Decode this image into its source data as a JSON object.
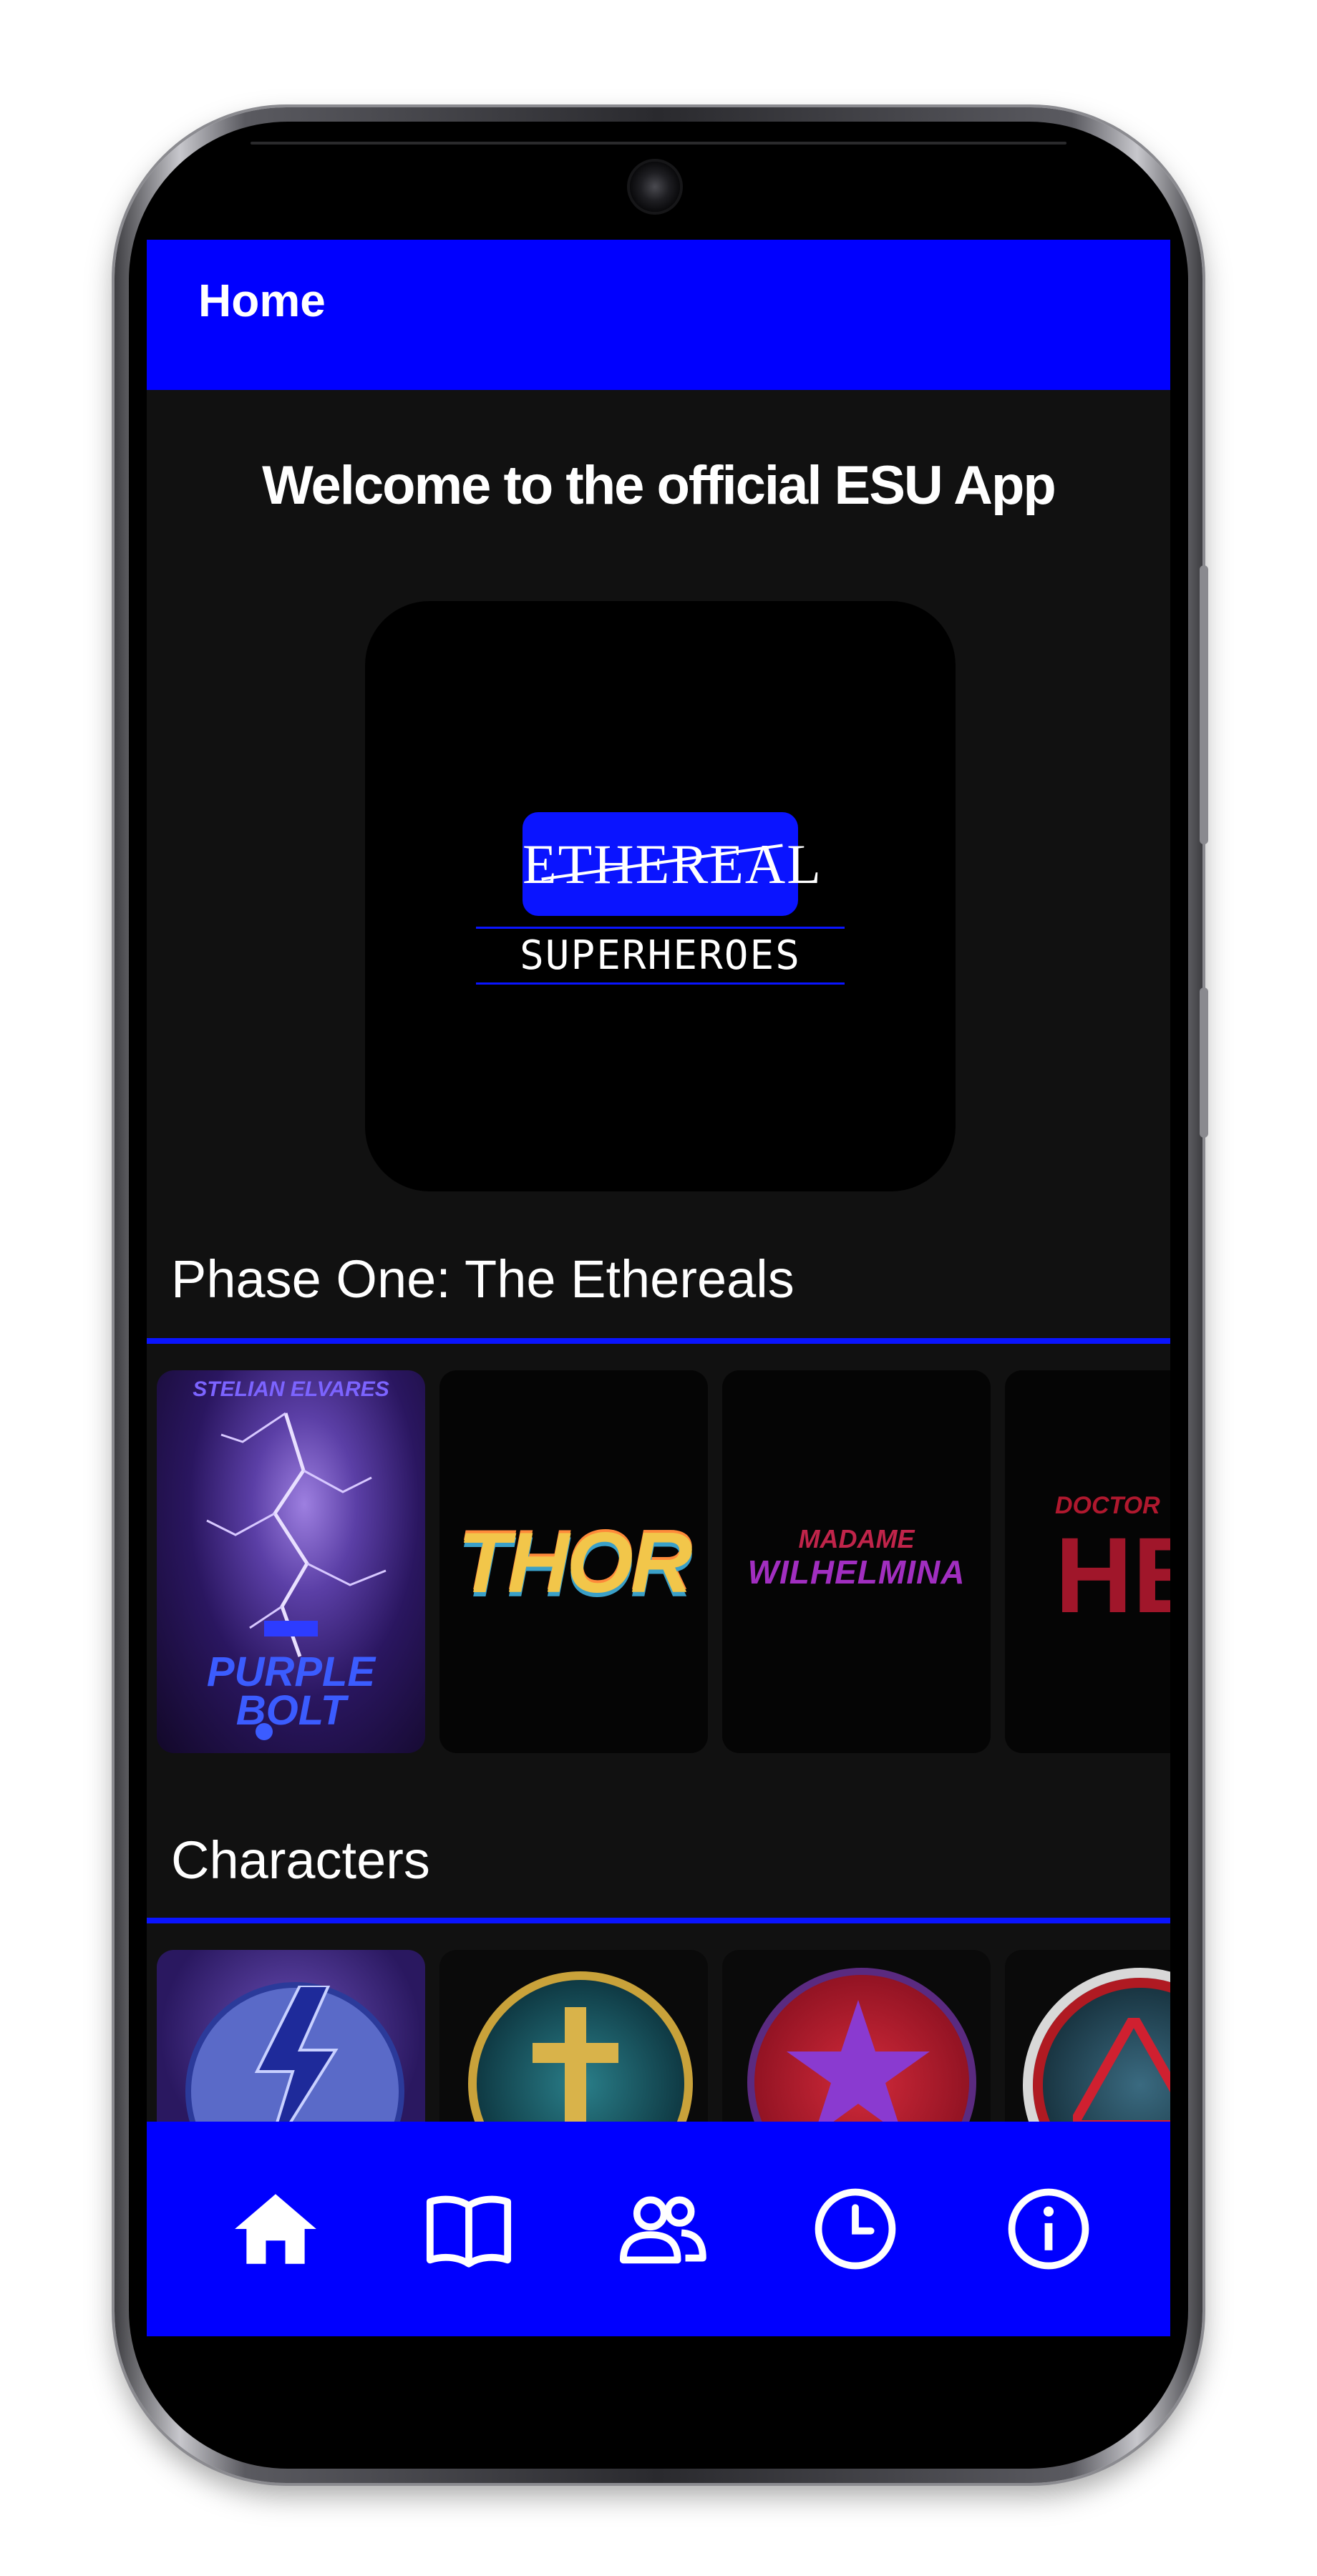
{
  "app_bar": {
    "title": "Home"
  },
  "welcome": {
    "text": "Welcome to the official ESU App"
  },
  "logo": {
    "line1": "ETHEREAL",
    "line2": "SUPERHEROES"
  },
  "phase_one": {
    "title": "Phase One: The Ethereals",
    "items": [
      {
        "top_text": "STELIAN ELVARES",
        "title": "PURPLE BOLT"
      },
      {
        "title": "THOR"
      },
      {
        "line1": "MADAME",
        "line2": "WILHELMINA"
      },
      {
        "line1": "DOCTOR",
        "line2": "HEX"
      }
    ]
  },
  "characters": {
    "title": "Characters",
    "items": [
      {
        "emblem": "lightning-bolt-emblem"
      },
      {
        "emblem": "gold-hammer-emblem"
      },
      {
        "emblem": "purple-star-emblem"
      },
      {
        "emblem": "red-triangle-emblem"
      }
    ]
  },
  "bottom_nav": {
    "items": [
      {
        "icon": "home-icon"
      },
      {
        "icon": "book-icon"
      },
      {
        "icon": "people-icon"
      },
      {
        "icon": "clock-icon"
      },
      {
        "icon": "info-icon"
      }
    ],
    "active_color": "#ffffff",
    "background": "#0000ff"
  },
  "colors": {
    "accent": "#0000ff",
    "background": "#111111"
  }
}
